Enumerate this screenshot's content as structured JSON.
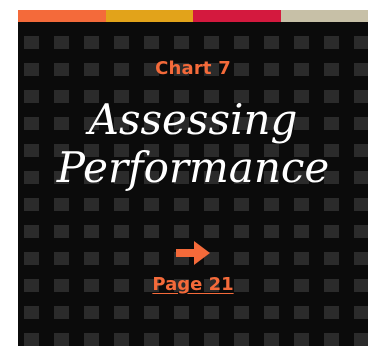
{
  "colors": {
    "accent": "#f46a3a",
    "background": "#0b0b0b",
    "title": "#ffffff",
    "bar": [
      "#f46a3a",
      "#e2a31a",
      "#d4193e",
      "#c7c0a7"
    ]
  },
  "card": {
    "eyebrow": "Chart 7",
    "title_line1": "Assessing",
    "title_line2": "Performance",
    "arrow_icon": "arrow-right-icon",
    "link_label": "Page 21"
  }
}
